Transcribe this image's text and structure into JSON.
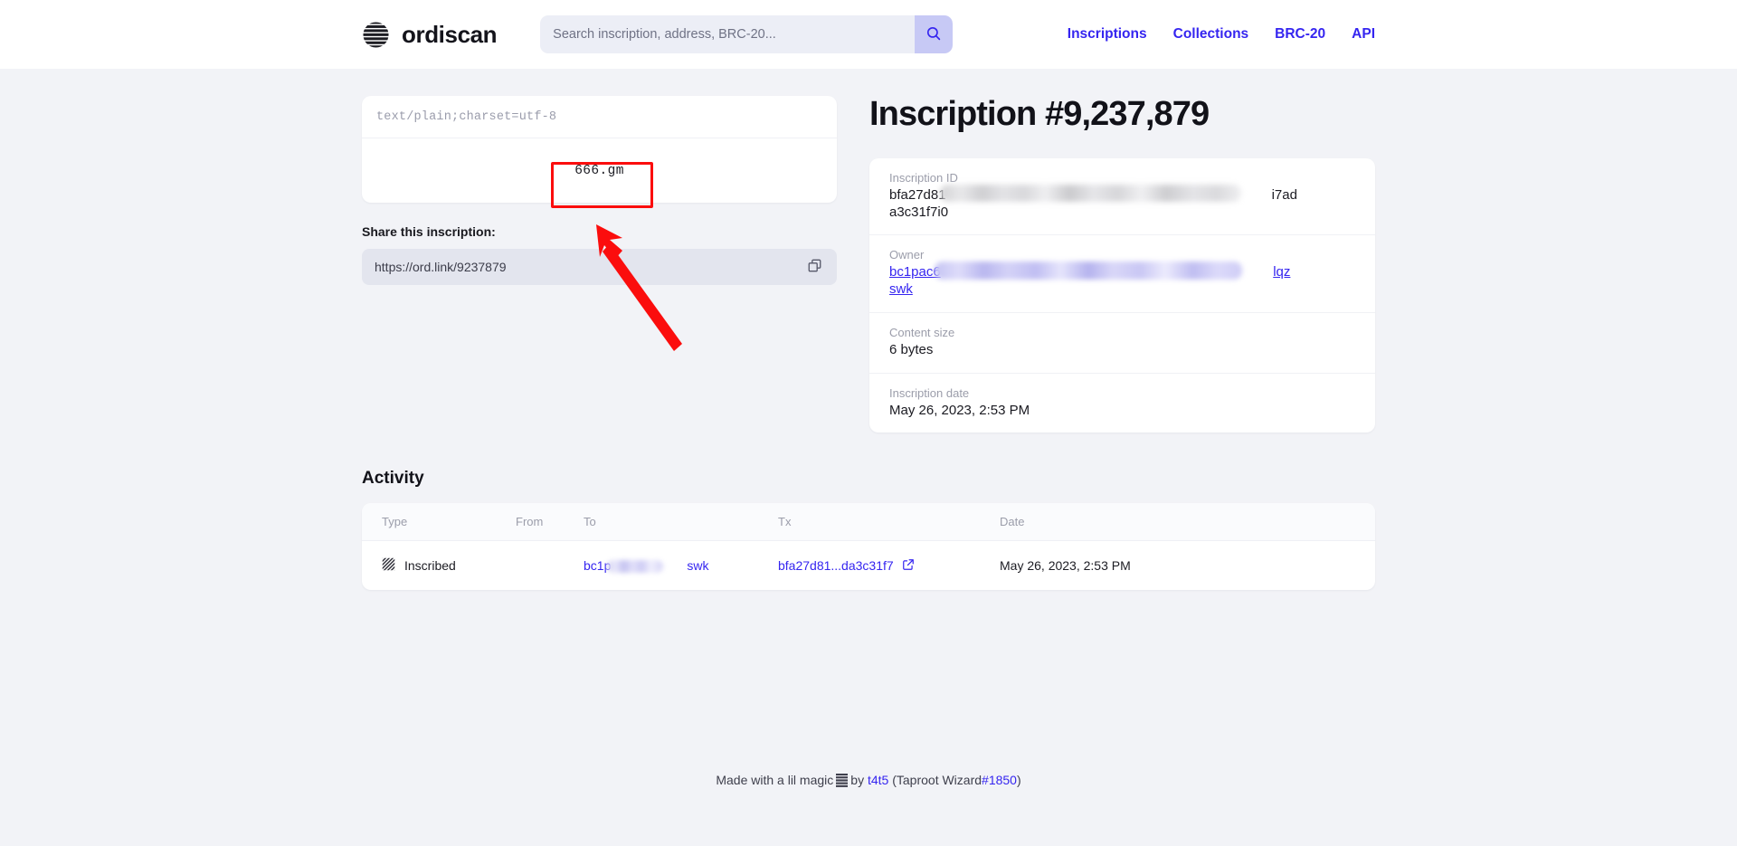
{
  "header": {
    "brand_name": "ordiscan",
    "logo_icon": "striped-circle-logo",
    "search": {
      "placeholder": "Search inscription, address, BRC-20...",
      "value": "",
      "button_icon": "search-icon"
    },
    "nav": [
      {
        "label": "Inscriptions"
      },
      {
        "label": "Collections"
      },
      {
        "label": "BRC-20"
      },
      {
        "label": "API"
      }
    ]
  },
  "preview": {
    "mime_type": "text/plain;charset=utf-8",
    "content_text": "666.gm"
  },
  "share": {
    "label": "Share this inscription:",
    "url": "https://ord.link/9237879",
    "copy_icon": "copy-icon"
  },
  "detail": {
    "title": "Inscription #9,237,879",
    "rows": [
      {
        "label": "Inscription ID",
        "value_prefix": "bfa27d81",
        "value_suffix": "i7ad",
        "value_wrap": "a3c31f7i0",
        "redacted": true,
        "link": false
      },
      {
        "label": "Owner",
        "value_prefix": "bc1pac6",
        "value_suffix": "lqz",
        "value_wrap": "swk",
        "redacted": true,
        "link": true
      },
      {
        "label": "Content size",
        "value": "6 bytes",
        "redacted": false,
        "link": false
      },
      {
        "label": "Inscription date",
        "value": "May 26, 2023, 2:53 PM",
        "redacted": false,
        "link": false
      }
    ]
  },
  "activity": {
    "title": "Activity",
    "columns": [
      "Type",
      "From",
      "To",
      "Tx",
      "Date"
    ],
    "rows": [
      {
        "type_icon": "hatched-square-icon",
        "type": "Inscribed",
        "from": "",
        "to_prefix": "bc1p",
        "to_suffix": "swk",
        "tx": "bfa27d81...da3c31f7",
        "tx_external_icon": "external-link-icon",
        "date": "May 26, 2023, 2:53 PM"
      }
    ]
  },
  "footer": {
    "text_before": "Made with a lil magic",
    "logo_icon": "striped-square-logo",
    "by_word": "by",
    "author": "t4t5",
    "paren_open": "(Taproot Wizard",
    "wizard_id": "#1850",
    "paren_close": ")"
  },
  "annotations": {
    "highlight_box_target": "666.gm",
    "arrow_color": "#fb0d0d",
    "box_color": "#fb0d0d"
  },
  "colors": {
    "accent": "#3525f0",
    "page_bg": "#f2f3f7",
    "card_bg": "#ffffff",
    "search_bg": "#eceef6",
    "search_btn_bg": "#c7c9f5",
    "muted_text": "#9b9daa",
    "annotation_red": "#fb0d0d"
  }
}
